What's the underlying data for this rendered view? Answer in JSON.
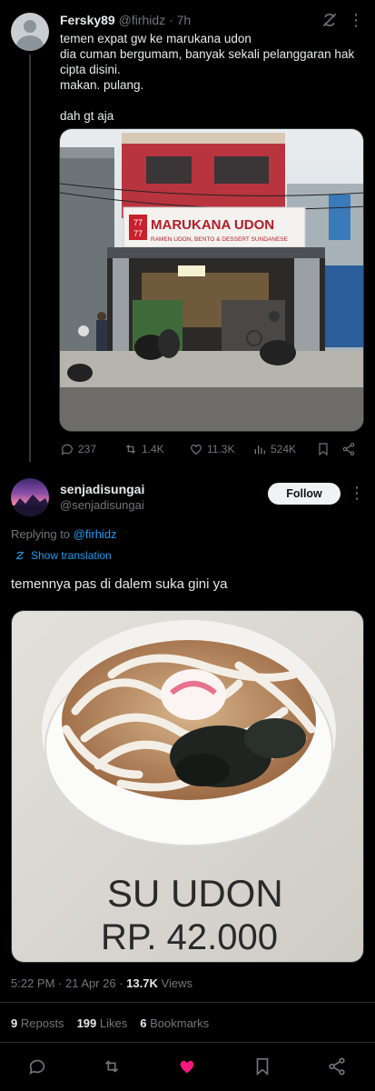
{
  "parent_tweet": {
    "author_name": "Fersky89",
    "author_handle": "@firhidz",
    "time": "· 7h",
    "lines": [
      "temen expat gw ke marukana udon",
      "dia cuman bergumam, banyak sekali pelanggaran hak",
      "cipta disini.",
      "makan. pulang.",
      "",
      "dah gt aja"
    ],
    "photo": {
      "sign_logo_top": "77",
      "sign_logo_bottom": "77",
      "sign_title": "MARUKANA UDON",
      "sign_subtitle": "RAMEN UDON, BENTO & DESSERT SUNDANESE"
    },
    "actions": {
      "replies": "237",
      "reposts": "1.4K",
      "likes": "11.3K",
      "views": "524K"
    }
  },
  "reply_tweet": {
    "author_name": "senjadisungai",
    "author_handle": "@senjadisungai",
    "follow_label": "Follow",
    "replying_prefix": "Replying to",
    "replying_to": "@firhidz",
    "show_translation": "Show translation",
    "text": "temennya pas di dalem suka gini ya",
    "photo": {
      "menu_item": "SU  UDON",
      "menu_price": "RP.  42.000"
    },
    "timestamp": "5:22 PM · 21 Apr 26 ·",
    "views_count": "13.7K",
    "views_label": "Views",
    "stats": {
      "reposts_count": "9",
      "reposts_label": "Reposts",
      "likes_count": "199",
      "likes_label": "Likes",
      "bookmarks_count": "6",
      "bookmarks_label": "Bookmarks"
    },
    "liked_color": "#f91880"
  },
  "colors": {
    "accent": "#1d9bf0",
    "muted": "#71767b",
    "background": "#000000",
    "text": "#e7e9ea"
  },
  "icons": [
    "reply-icon",
    "repost-icon",
    "like-icon",
    "views-icon",
    "bookmark-icon",
    "share-icon",
    "grok-icon",
    "more-icon",
    "translate-icon"
  ]
}
